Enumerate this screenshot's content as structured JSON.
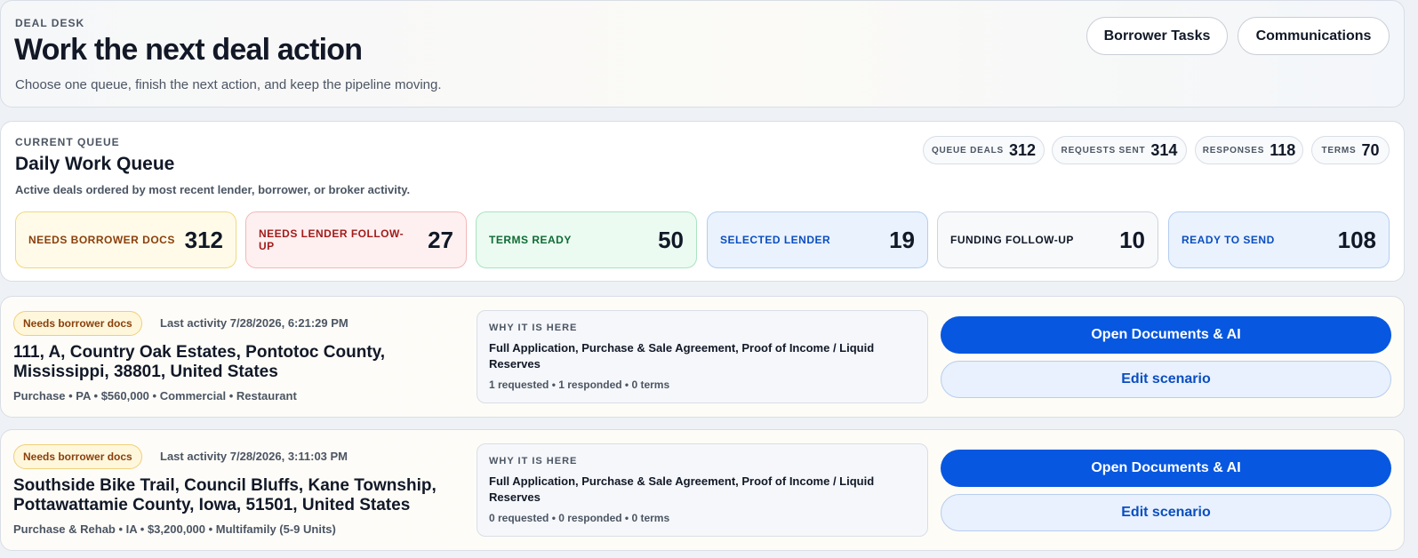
{
  "header": {
    "eyebrow": "DEAL DESK",
    "title": "Work the next deal action",
    "subtitle": "Choose one queue, finish the next action, and keep the pipeline moving.",
    "buttons": {
      "borrower_tasks": "Borrower Tasks",
      "communications": "Communications"
    }
  },
  "queue": {
    "eyebrow": "CURRENT QUEUE",
    "title": "Daily Work Queue",
    "subtitle": "Active deals ordered by most recent lender, borrower, or broker activity.",
    "stats": [
      {
        "label": "QUEUE DEALS",
        "value": "312"
      },
      {
        "label": "REQUESTS SENT",
        "value": "314"
      },
      {
        "label": "RESPONSES",
        "value": "118"
      },
      {
        "label": "TERMS",
        "value": "70"
      }
    ],
    "buckets": [
      {
        "label": "NEEDS BORROWER DOCS",
        "value": "312",
        "bg": "#fffbe8",
        "border": "#f2d77f",
        "color": "#8a3f0b"
      },
      {
        "label": "NEEDS LENDER FOLLOW-UP",
        "value": "27",
        "bg": "#fef0f0",
        "border": "#f3b8b8",
        "color": "#a31b1b"
      },
      {
        "label": "TERMS READY",
        "value": "50",
        "bg": "#ebfbf1",
        "border": "#a9e3c0",
        "color": "#0f6b34"
      },
      {
        "label": "SELECTED LENDER",
        "value": "19",
        "bg": "#eaf2fd",
        "border": "#b3cdf0",
        "color": "#0a4ec0"
      },
      {
        "label": "FUNDING FOLLOW-UP",
        "value": "10",
        "bg": "#f7f9fb",
        "border": "#cfd5de",
        "color": "#111827"
      },
      {
        "label": "READY TO SEND",
        "value": "108",
        "bg": "#eaf2fd",
        "border": "#b3cdf0",
        "color": "#0a4ec0"
      }
    ]
  },
  "deals": [
    {
      "badge": "Needs borrower docs",
      "activity": "Last activity 7/28/2026, 6:21:29 PM",
      "address": "111, A, Country Oak Estates, Pontotoc County, Mississippi, 38801, United States",
      "meta": "Purchase • PA • $560,000 • Commercial • Restaurant",
      "why_label": "WHY IT IS HERE",
      "why_docs": "Full Application, Purchase & Sale Agreement, Proof of Income / Liquid Reserves",
      "why_counts": "1 requested • 1 responded • 0 terms",
      "primary": "Open Documents & AI",
      "secondary": "Edit scenario"
    },
    {
      "badge": "Needs borrower docs",
      "activity": "Last activity 7/28/2026, 3:11:03 PM",
      "address": "Southside Bike Trail, Council Bluffs, Kane Township, Pottawattamie County, Iowa, 51501, United States",
      "meta": "Purchase & Rehab • IA • $3,200,000 • Multifamily (5-9 Units)",
      "why_label": "WHY IT IS HERE",
      "why_docs": "Full Application, Purchase & Sale Agreement, Proof of Income / Liquid Reserves",
      "why_counts": "0 requested • 0 responded • 0 terms",
      "primary": "Open Documents & AI",
      "secondary": "Edit scenario"
    }
  ]
}
